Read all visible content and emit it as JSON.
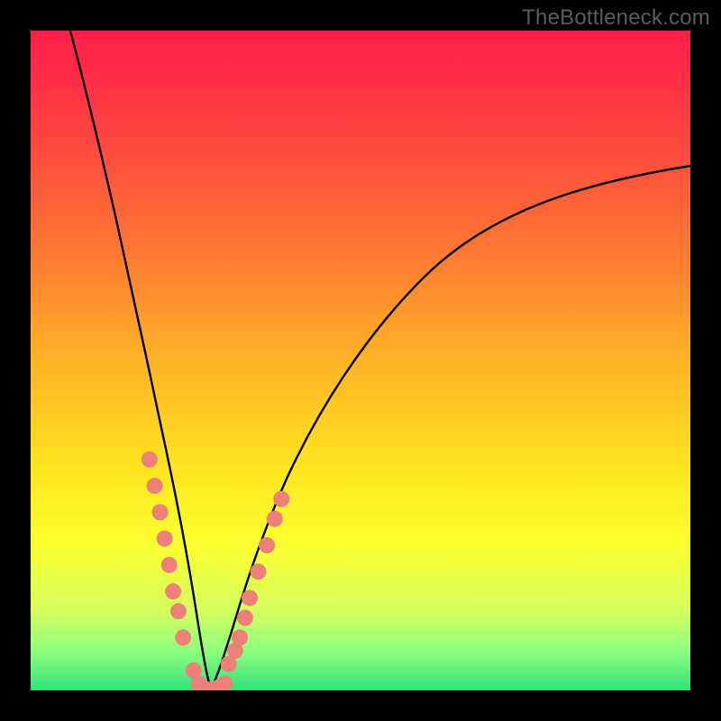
{
  "watermark": "TheBottleneck.com",
  "chart_data": {
    "type": "line",
    "title": "",
    "xlabel": "",
    "ylabel": "",
    "xlim": [
      0,
      100
    ],
    "ylim": [
      0,
      100
    ],
    "grid": false,
    "legend": false,
    "series": [
      {
        "name": "curve-left",
        "x": [
          6,
          8,
          10,
          12,
          14,
          16,
          18,
          20,
          21,
          22,
          23,
          24,
          25,
          26,
          27
        ],
        "y": [
          100,
          92,
          82,
          71,
          60,
          48,
          36,
          24,
          18,
          13,
          8,
          5,
          2,
          1,
          0
        ]
      },
      {
        "name": "curve-right",
        "x": [
          27,
          28,
          30,
          31,
          33,
          36,
          40,
          46,
          54,
          64,
          76,
          90,
          100
        ],
        "y": [
          0,
          1,
          3,
          4,
          9,
          17,
          27,
          38,
          49,
          59,
          68,
          75,
          79
        ]
      },
      {
        "name": "dots-left",
        "x": [
          18.0,
          18.8,
          19.6,
          20.3,
          21.0,
          21.6,
          22.4,
          23.1,
          24.7,
          25.5
        ],
        "y": [
          35,
          31,
          27,
          23,
          19,
          15,
          12,
          8,
          3,
          1
        ]
      },
      {
        "name": "dots-right",
        "x": [
          30.0,
          31.0,
          31.7,
          32.5,
          33.2,
          34.5,
          35.8,
          37.0,
          38.0
        ],
        "y": [
          4,
          6,
          8,
          11,
          14,
          18,
          22,
          26,
          29
        ]
      },
      {
        "name": "dots-valley",
        "x": [
          25.8,
          26.4,
          27.0,
          27.8,
          28.6,
          29.4
        ],
        "y": [
          0.5,
          0.2,
          0.1,
          0.2,
          0.5,
          1.0
        ]
      }
    ],
    "colors": {
      "curve": "#000000",
      "dots": "#ed8079"
    }
  }
}
